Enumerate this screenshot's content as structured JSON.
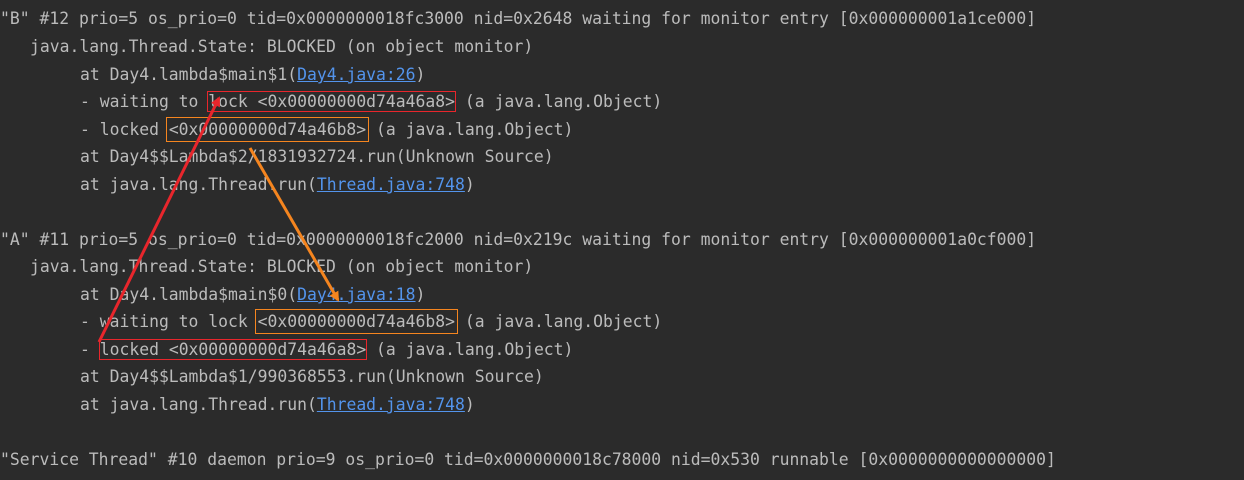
{
  "colors": {
    "background": "#2b2b2b",
    "text": "#bbbbbb",
    "link": "#5394ec",
    "highlight_red": "#e8262c",
    "highlight_orange": "#f5851f"
  },
  "thread_b": {
    "header": "\"B\" #12 prio=5 os_prio=0 tid=0x0000000018fc3000 nid=0x2648 waiting for monitor entry [0x000000001a1ce000]",
    "state": "java.lang.Thread.State: BLOCKED (on object monitor)",
    "frame1_prefix": "at Day4.lambda$main$1(",
    "frame1_link": "Day4.java:26",
    "frame1_suffix": ")",
    "waiting_prefix": "- waiting to ",
    "waiting_lock": "lock <0x00000000d74a46a8>",
    "waiting_suffix": " (a java.lang.Object)",
    "locked_prefix": "- locked ",
    "locked_addr": "<0x00000000d74a46b8>",
    "locked_suffix": " (a java.lang.Object)",
    "frame2": "at Day4$$Lambda$2/1831932724.run(Unknown Source)",
    "frame3_prefix": "at java.lang.Thread.run(",
    "frame3_link": "Thread.java:748",
    "frame3_suffix": ")"
  },
  "thread_a": {
    "header": "\"A\" #11 prio=5 os_prio=0 tid=0x0000000018fc2000 nid=0x219c waiting for monitor entry [0x000000001a0cf000]",
    "state": "java.lang.Thread.State: BLOCKED (on object monitor)",
    "frame1_prefix": "at Day4.lambda$main$0(",
    "frame1_link": "Day4.java:18",
    "frame1_suffix": ")",
    "waiting_prefix": "- waiting to lock ",
    "waiting_addr": "<0x00000000d74a46b8>",
    "waiting_suffix": " (a java.lang.Object)",
    "locked_prefix": "- ",
    "locked_lock": "locked <0x00000000d74a46a8>",
    "locked_suffix": " (a java.lang.Object)",
    "frame2": "at Day4$$Lambda$1/990368553.run(Unknown Source)",
    "frame3_prefix": "at java.lang.Thread.run(",
    "frame3_link": "Thread.java:748",
    "frame3_suffix": ")"
  },
  "service_thread": {
    "header": "\"Service Thread\" #10 daemon prio=9 os_prio=0 tid=0x0000000018c78000 nid=0x530 runnable [0x0000000000000000]"
  }
}
